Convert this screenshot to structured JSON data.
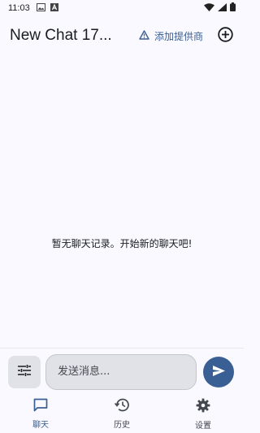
{
  "status_bar": {
    "time": "11:03",
    "icons": [
      "gallery-icon",
      "a-icon",
      "wifi-icon",
      "signal-icon",
      "battery-icon"
    ]
  },
  "header": {
    "title": "New Chat 17...",
    "provider_button_label": "添加提供商",
    "provider_icon": "warning-triangle-icon",
    "add_icon": "add-circle-icon"
  },
  "main": {
    "empty_message": "暂无聊天记录。开始新的聊天吧!"
  },
  "composer": {
    "placeholder": "发送消息...",
    "settings_icon": "tune-icon",
    "send_icon": "send-icon"
  },
  "nav": {
    "items": [
      {
        "label": "聊天",
        "icon": "chat-icon",
        "active": true
      },
      {
        "label": "历史",
        "icon": "history-icon",
        "active": false
      },
      {
        "label": "设置",
        "icon": "gear-icon",
        "active": false
      }
    ]
  },
  "colors": {
    "accent": "#3a5f94",
    "background": "#f9f9ff",
    "surface_variant": "#e1e2e8"
  }
}
